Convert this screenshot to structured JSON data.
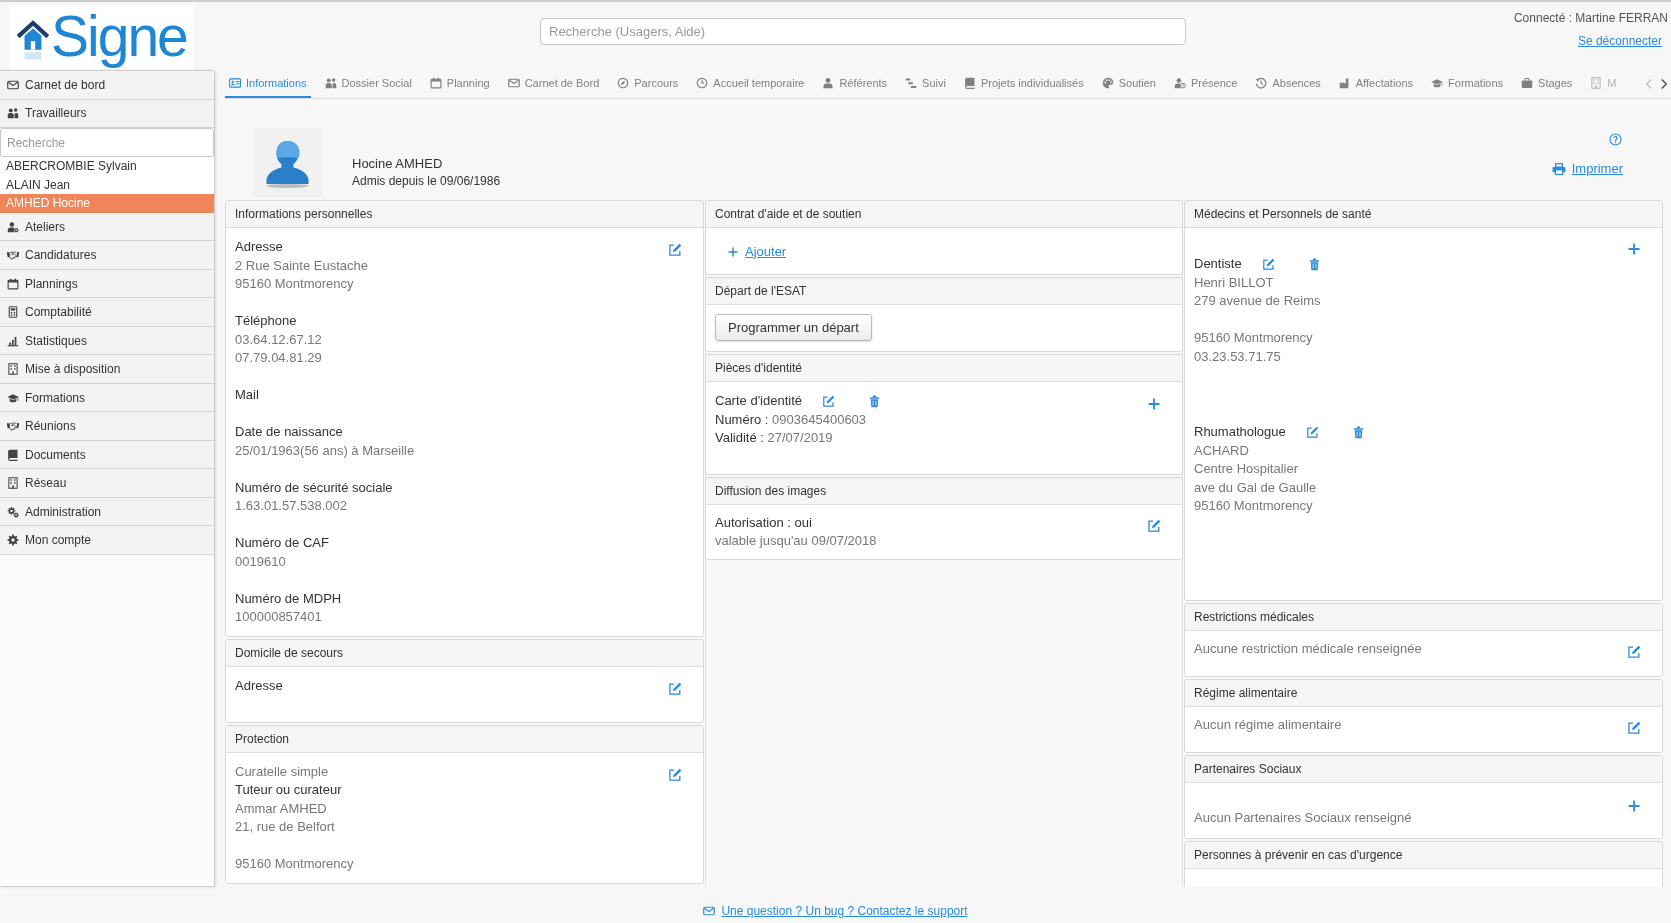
{
  "header": {
    "logo": "Signe",
    "search": {
      "placeholder": "Recherche (Usagers, Aide)"
    },
    "connected": "Connecté : Martine FERRAN",
    "logout": "Se déconnecter"
  },
  "sidebar": {
    "top_items": [
      {
        "label": "Carnet de bord"
      },
      {
        "label": "Travailleurs"
      }
    ],
    "search": {
      "placeholder": "Recherche"
    },
    "people": [
      {
        "name": "ABERCROMBIE Sylvain",
        "selected": false
      },
      {
        "name": "ALAIN Jean",
        "selected": false
      },
      {
        "name": "AMHED Hocine",
        "selected": true
      }
    ],
    "items": [
      {
        "label": "Ateliers"
      },
      {
        "label": "Candidatures"
      },
      {
        "label": "Plannings"
      },
      {
        "label": "Comptabilité"
      },
      {
        "label": "Statistiques"
      },
      {
        "label": "Mise à disposition"
      },
      {
        "label": "Formations"
      },
      {
        "label": "Réunions"
      },
      {
        "label": "Documents"
      },
      {
        "label": "Réseau"
      },
      {
        "label": "Administration"
      },
      {
        "label": "Mon compte"
      }
    ]
  },
  "tabs": [
    {
      "label": "Informations",
      "selected": true
    },
    {
      "label": "Dossier Social",
      "selected": false
    },
    {
      "label": "Planning",
      "selected": false
    },
    {
      "label": "Carnet de Bord",
      "selected": false
    },
    {
      "label": "Parcours",
      "selected": false
    },
    {
      "label": "Accueil temporaire",
      "selected": false
    },
    {
      "label": "Référents",
      "selected": false
    },
    {
      "label": "Suivi",
      "selected": false
    },
    {
      "label": "Projets individualisés",
      "selected": false
    },
    {
      "label": "Soutien",
      "selected": false
    },
    {
      "label": "Présence",
      "selected": false
    },
    {
      "label": "Absences",
      "selected": false
    },
    {
      "label": "Affectations",
      "selected": false
    },
    {
      "label": "Formations",
      "selected": false
    },
    {
      "label": "Stages",
      "selected": false
    },
    {
      "label": "M",
      "selected": false
    }
  ],
  "profile": {
    "name": "Hocine AMHED",
    "admitted": "Admis depuis le 09/06/1986",
    "print": "Imprimer"
  },
  "columns": [
    {
      "panels": [
        {
          "title": "Informations personnelles",
          "kind": "fields",
          "items": [
            {
              "label": "Adresse",
              "blocks": [
                [
                  "2 Rue Sainte Eustache",
                  "95160 Montmorency"
                ]
              ]
            },
            {
              "label": "Téléphone",
              "blocks": [
                [
                  "03.64.12.67.12",
                  "07.79.04.81.29"
                ]
              ]
            },
            {
              "label": "Mail"
            },
            {
              "label": "Date de naissance",
              "blocks": [
                [
                  "25/01/1963(56 ans) à Marseille"
                ]
              ]
            },
            {
              "label": "Numéro de sécurité sociale",
              "blocks": [
                [
                  "1.63.01.57.538.002"
                ]
              ]
            },
            {
              "label": "Numéro de CAF",
              "blocks": [
                [
                  "0019610"
                ]
              ]
            },
            {
              "label": "Numéro de MDPH",
              "blocks": [
                [
                  "100000857401"
                ]
              ]
            }
          ]
        },
        {
          "title": "Domicile de secours",
          "kind": "fields",
          "items": [
            {
              "label": "Adresse"
            }
          ]
        },
        {
          "title": "Protection",
          "kind": "fields",
          "status": "Curatelle simple",
          "items": [
            {
              "label": "Tuteur ou curateur",
              "blocks": [
                [
                  "Ammar AMHED",
                  "21, rue de Belfort"
                ],
                [
                  "95160 Montmorency"
                ]
              ]
            }
          ]
        }
      ]
    },
    {
      "panels": [
        {
          "title": "Contrat d'aide et de soutien",
          "kind": "add_link",
          "link": "Ajouter"
        },
        {
          "title": "Départ de l'ESAT",
          "kind": "button",
          "button": "Programmer un départ"
        },
        {
          "title": "Pièces d'identité",
          "kind": "documents",
          "entries": [
            {
              "title": "Carte d'identité",
              "rows": [
                {
                  "label": "Numéro :",
                  "value": "0903645400603"
                },
                {
                  "label": "Validité :",
                  "value": "27/07/2019"
                }
              ]
            }
          ]
        },
        {
          "title": "Diffusion des images",
          "kind": "note",
          "text": "Autorisation : oui",
          "detail": "valable jusqu'au 09/07/2018"
        }
      ]
    },
    {
      "panels": [
        {
          "title": "Médecins et Personnels de santé",
          "kind": "contacts",
          "entries": [
            {
              "title": "Dentiste",
              "blocks": [
                [
                  "Henri BILLOT",
                  "279 avenue de Reims"
                ],
                [
                  "95160 Montmorency",
                  "03.23.53.71.75"
                ]
              ]
            },
            {
              "title": "Rhumathologue",
              "blocks": [
                [
                  "ACHARD",
                  "Centre Hospitalier",
                  "ave du Gal de Gaulle",
                  "95160 Montmorency"
                ]
              ]
            }
          ]
        },
        {
          "title": "Restrictions médicales",
          "kind": "empty_edit",
          "text": "Aucune restriction médicale renseignée"
        },
        {
          "title": "Régime alimentaire",
          "kind": "empty_edit",
          "text": "Aucun régime alimentaire"
        },
        {
          "title": "Partenaires Sociaux",
          "kind": "empty_add",
          "text": "Aucun Partenaires Sociaux renseigné"
        },
        {
          "title": "Personnes à prévenir en cas d'urgence",
          "kind": "blank"
        }
      ]
    }
  ],
  "footer": {
    "support": "Une question ? Un bug ? Contactez le support"
  }
}
